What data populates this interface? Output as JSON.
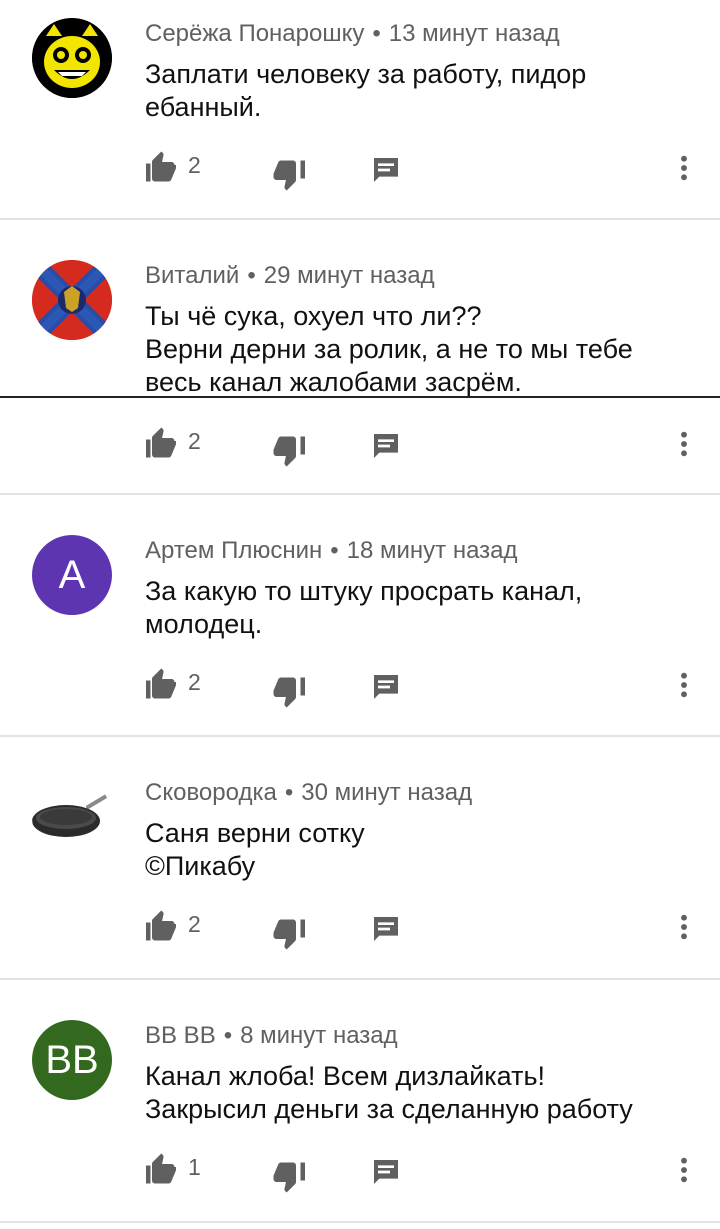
{
  "comments": [
    {
      "author": "Серёжа Понарошку",
      "time": "13 минут назад",
      "lines": [
        "Заплати человеку за работу, пидор",
        "ебанный."
      ],
      "likes": "2",
      "avatar": {
        "type": "image",
        "icon": "cartoon-cat-avatar",
        "bg": "#000000"
      }
    },
    {
      "author": "Виталий",
      "time": "29 минут назад",
      "lines": [
        "Ты чё сука, охуел что ли??",
        "Верни дерни за ролик, а не то мы тебе",
        "весь канал жалобами засрём."
      ],
      "likes": "2",
      "avatar": {
        "type": "image",
        "icon": "flag-emblem-avatar",
        "bg": "#d52b1e"
      }
    },
    {
      "author": "Артем Плюснин",
      "time": "18 минут назад",
      "lines": [
        "За какую то штуку просрать канал,",
        "молодец."
      ],
      "likes": "2",
      "avatar": {
        "type": "letter",
        "letter": "А",
        "bg": "#5e35b1"
      }
    },
    {
      "author": "Сковородка",
      "time": "30 минут назад",
      "lines": [
        "Саня верни сотку",
        "©Пикабу"
      ],
      "likes": "2",
      "avatar": {
        "type": "image",
        "icon": "frying-pan-avatar",
        "bg": "#ffffff"
      }
    },
    {
      "author": "BB BB",
      "time": "8 минут назад",
      "lines": [
        "Канал жлоба! Всем дизлайкать!",
        "Закрысил деньги за сделанную работу"
      ],
      "likes": "1",
      "avatar": {
        "type": "letter",
        "letter": "BB",
        "bg": "#33691e"
      }
    }
  ],
  "separator": "•",
  "colors": {
    "meta": "#606060",
    "text": "#111111",
    "divider": "#e4e4e4",
    "icon": "#606060"
  }
}
